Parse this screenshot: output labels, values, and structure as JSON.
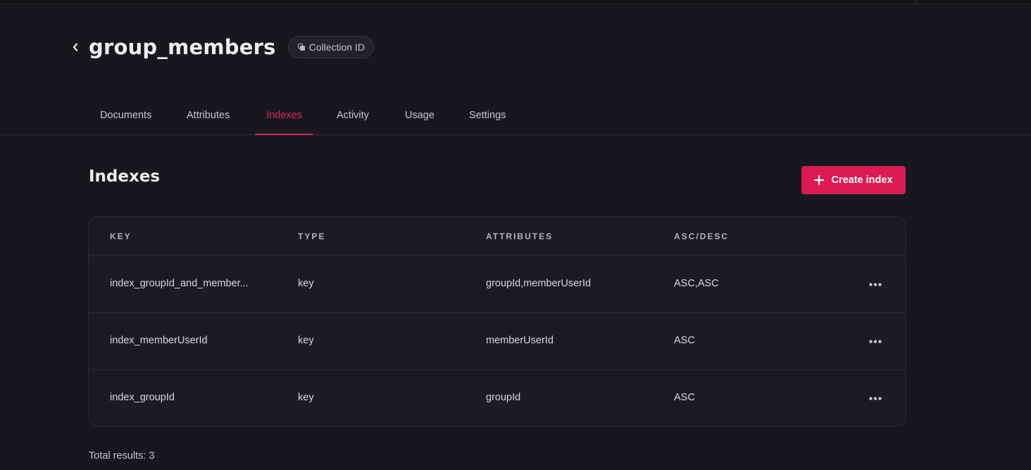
{
  "header": {
    "title": "group_members",
    "id_badge_label": "Collection ID"
  },
  "tabs": [
    {
      "label": "Documents",
      "active": false
    },
    {
      "label": "Attributes",
      "active": false
    },
    {
      "label": "Indexes",
      "active": true
    },
    {
      "label": "Activity",
      "active": false
    },
    {
      "label": "Usage",
      "active": false
    },
    {
      "label": "Settings",
      "active": false
    }
  ],
  "section": {
    "title": "Indexes",
    "create_button_label": "Create index"
  },
  "table": {
    "columns": [
      "KEY",
      "TYPE",
      "ATTRIBUTES",
      "ASC/DESC"
    ],
    "rows": [
      {
        "key": "index_groupId_and_member...",
        "type": "key",
        "attributes": "groupId,memberUserId",
        "order": "ASC,ASC"
      },
      {
        "key": "index_memberUserId",
        "type": "key",
        "attributes": "memberUserId",
        "order": "ASC"
      },
      {
        "key": "index_groupId",
        "type": "key",
        "attributes": "groupId",
        "order": "ASC"
      }
    ]
  },
  "footer": {
    "total_results": "Total results: 3"
  },
  "colors": {
    "accent": "#dc1a54",
    "background": "#17171f",
    "card": "#1b1b24"
  }
}
